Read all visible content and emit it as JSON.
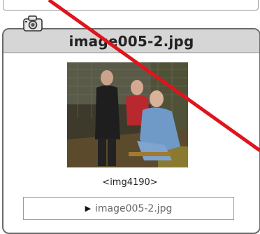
{
  "panel": {
    "title": "image005-2.jpg",
    "caption": "<img4190>",
    "file_link": {
      "label": "image005-2.jpg",
      "icon": "play-arrow-icon"
    },
    "header_icon": "camera-icon",
    "photo_description_icon": "photo-thumbnail"
  },
  "colors": {
    "header_bg": "#d6d6d6",
    "border": "#6a6a6a",
    "slash": "#e0141c"
  }
}
